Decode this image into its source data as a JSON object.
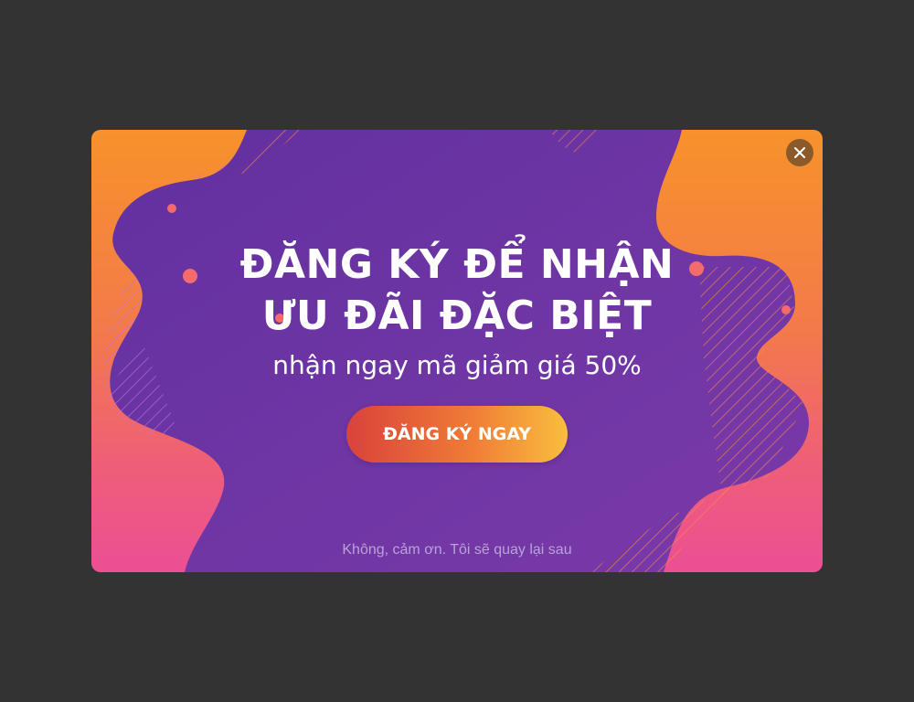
{
  "modal": {
    "headline_line1": "ĐĂNG KÝ ĐỂ NHẬN",
    "headline_line2": "ƯU ĐÃI ĐẶC BIỆT",
    "subtitle": "nhận ngay mã giảm giá 50%",
    "cta_label": "ĐĂNG KÝ NGAY",
    "dismiss_label": "Không, cảm ơn. Tôi sẽ quay lại sau",
    "close_icon": "close-icon"
  },
  "colors": {
    "page_background": "#333333",
    "modal_gradient_top": "#f7922b",
    "modal_gradient_bottom": "#ec4f93",
    "blob_purple": "#6a32a0",
    "cta_gradient_start": "#d9423c",
    "cta_gradient_end": "#f9be3e",
    "close_button": "#8a5a2a",
    "dismiss_text": "#b9a3d8"
  }
}
